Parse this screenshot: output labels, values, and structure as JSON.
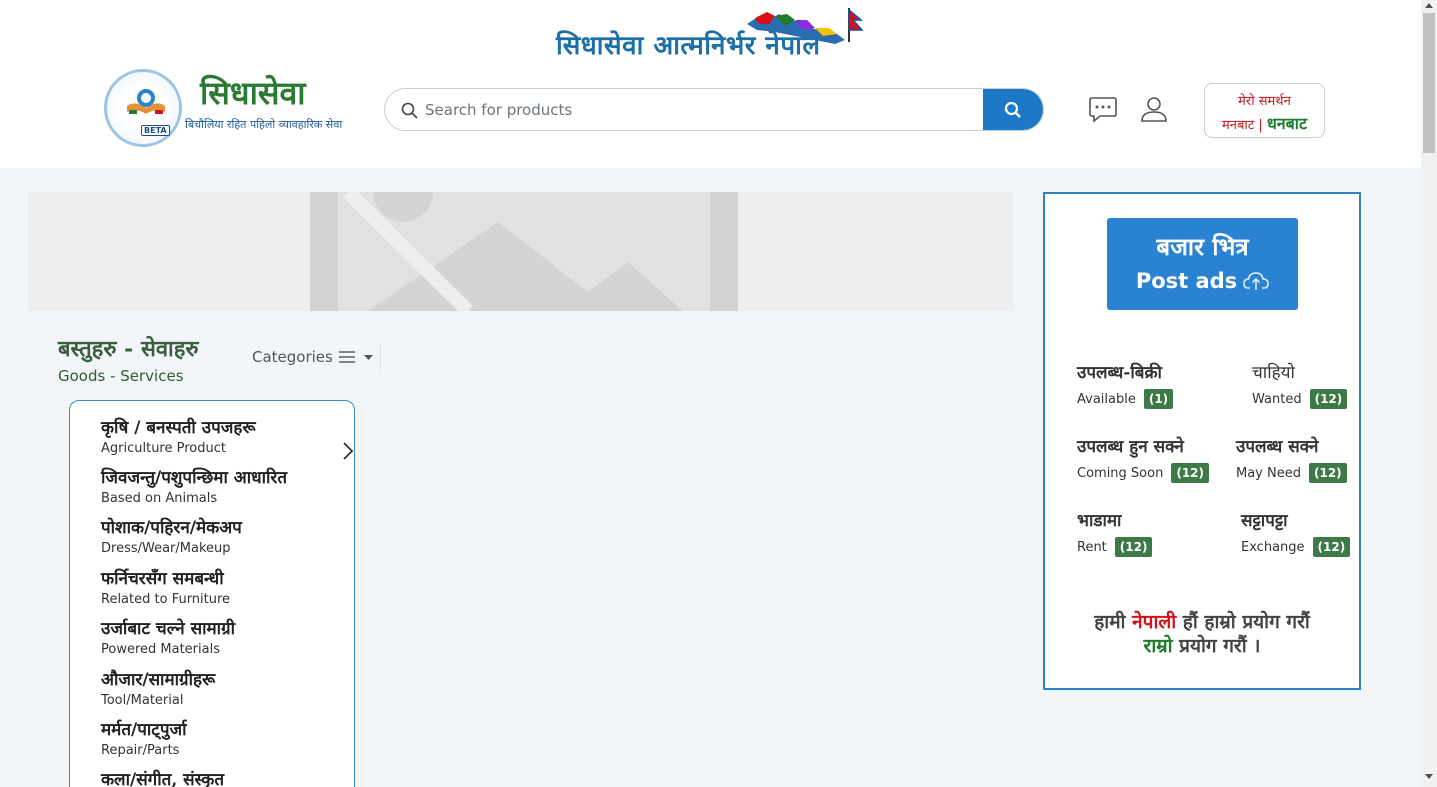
{
  "header": {
    "tagline": "सिधासेवा आत्मनिर्भर नेपाल",
    "logo": {
      "title": "सिधासेवा",
      "subtitle": "बिचौलिया रहित पहिलो व्यावहारिक सेवा",
      "badge": "BETA"
    },
    "search": {
      "placeholder": "Search for products",
      "value": ""
    },
    "support": {
      "line1": "मेरो समर्थन",
      "line2_prefix": "मनबाट |",
      "line2_bold": "धनबाट"
    }
  },
  "goods": {
    "title": "बस्तुहरु - सेवाहरु",
    "subtitle": "Goods - Services",
    "categories_label": "Categories",
    "items": [
      {
        "np": "कृषि / बनस्पती उपजहरू",
        "en": "Agriculture Product"
      },
      {
        "np": "जिवजन्तु/पशुपन्छिमा आधारित",
        "en": "Based on Animals"
      },
      {
        "np": "पोशाक/पहिरन/मेकअप",
        "en": "Dress/Wear/Makeup"
      },
      {
        "np": "फर्निचरसँग समबन्धी",
        "en": "Related to Furniture"
      },
      {
        "np": "उर्जाबाट चल्ने सामाग्री",
        "en": "Powered Materials"
      },
      {
        "np": "औजार/सामाग्रीहरू",
        "en": "Tool/Material"
      },
      {
        "np": "मर्मत/पाट्पुर्जा",
        "en": "Repair/Parts"
      },
      {
        "np": "कला/संगीत, संस्कृत",
        "en": ""
      }
    ]
  },
  "side": {
    "post_np": "बजार भित्र",
    "post_en": "Post ads",
    "stats": [
      {
        "np": "उपलब्ध-बिक्री",
        "en": "Available",
        "count": "(1)"
      },
      {
        "np": "चाहियो",
        "en": "Wanted",
        "count": "(12)"
      },
      {
        "np": "उपलब्ध हुन सक्ने",
        "en": "Coming Soon",
        "count": "(12)"
      },
      {
        "np": "उपलब्ध सक्ने",
        "en": "May Need",
        "count": "(12)"
      },
      {
        "np": "भाडामा",
        "en": "Rent",
        "count": "(12)"
      },
      {
        "np": "सट्टापट्टा",
        "en": "Exchange",
        "count": "(12)"
      }
    ],
    "slogan": {
      "a": "हामी",
      "b": "नेपाली",
      "c": "हौं हाम्रो प्रयोग गरौं",
      "d": "राम्रो",
      "e": "प्रयोग गरौं ।"
    }
  },
  "colors": {
    "primary_blue": "#1d79c6",
    "brand_green": "#2a7a34",
    "badge_green": "#3d7a47",
    "accent_red": "#d6101a"
  }
}
